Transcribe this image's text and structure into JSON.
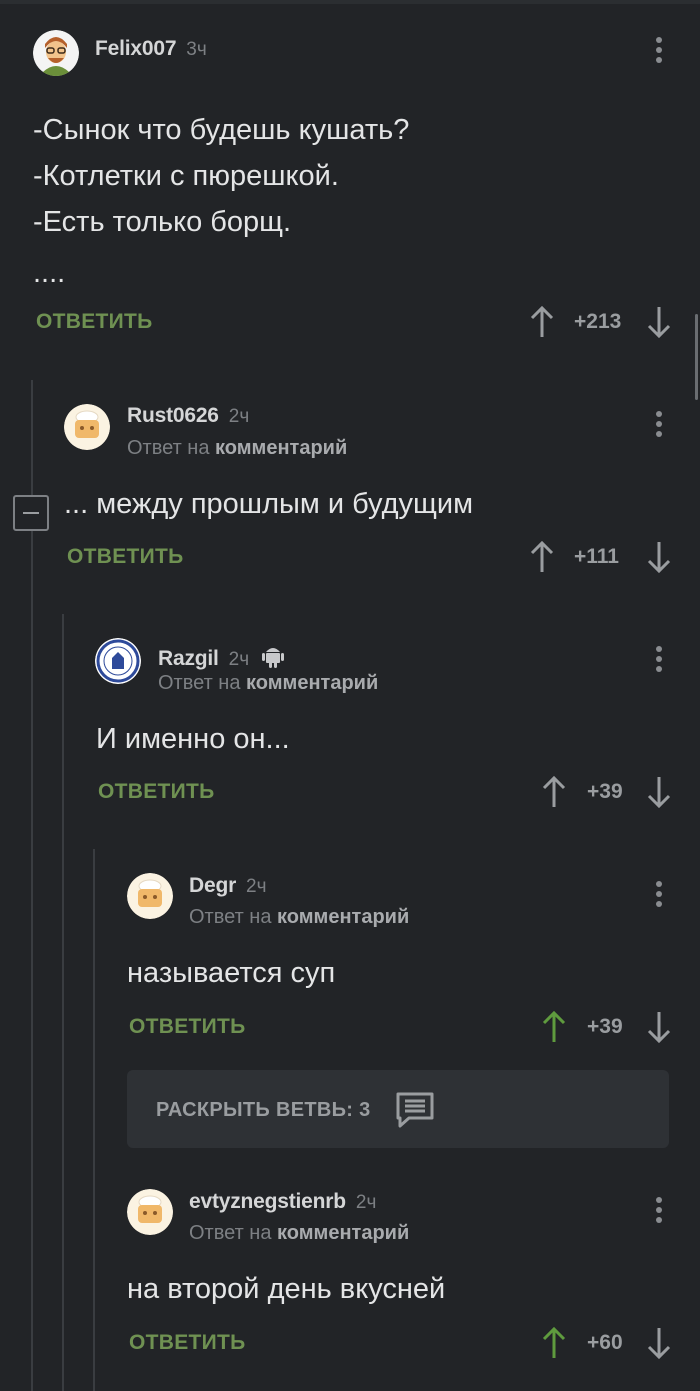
{
  "comments": [
    {
      "author": "Felix007",
      "time": "3ч",
      "lines": [
        "-Сынок что будешь кушать?",
        "-Котлетки с пюрешкой.",
        "-Есть только борщ.",
        "...."
      ],
      "reply_label": "ОТВЕТИТЬ",
      "rating": "+213",
      "upvoted": false
    },
    {
      "author": "Rust0626",
      "time": "2ч",
      "reply_to_prefix": "Ответ на",
      "reply_to_link": "комментарий",
      "lines": [
        "... между прошлым и будущим"
      ],
      "reply_label": "ОТВЕТИТЬ",
      "rating": "+111",
      "upvoted": false
    },
    {
      "author": "Razgil",
      "time": "2ч",
      "reply_to_prefix": "Ответ на",
      "reply_to_link": "комментарий",
      "lines": [
        "И именно он..."
      ],
      "reply_label": "ОТВЕТИТЬ",
      "rating": "+39",
      "upvoted": false
    },
    {
      "author": "Degr",
      "time": "2ч",
      "reply_to_prefix": "Ответ на",
      "reply_to_link": "комментарий",
      "lines": [
        "называется суп"
      ],
      "reply_label": "ОТВЕТИТЬ",
      "rating": "+39",
      "upvoted": true
    },
    {
      "author": "evtyznegstienrb",
      "time": "2ч",
      "reply_to_prefix": "Ответ на",
      "reply_to_link": "комментарий",
      "lines": [
        "на второй день вкусней"
      ],
      "reply_label": "ОТВЕТИТЬ",
      "rating": "+60",
      "upvoted": true
    }
  ],
  "expand_branch": {
    "label": "РАСКРЫТЬ ВЕТВЬ: 3",
    "icon": "comments-icon"
  },
  "colors": {
    "background": "#222427",
    "reply_green": "#6f9152",
    "upvote_active": "#5f9b3e",
    "muted": "#7d8084",
    "text": "#e4e5e6"
  }
}
